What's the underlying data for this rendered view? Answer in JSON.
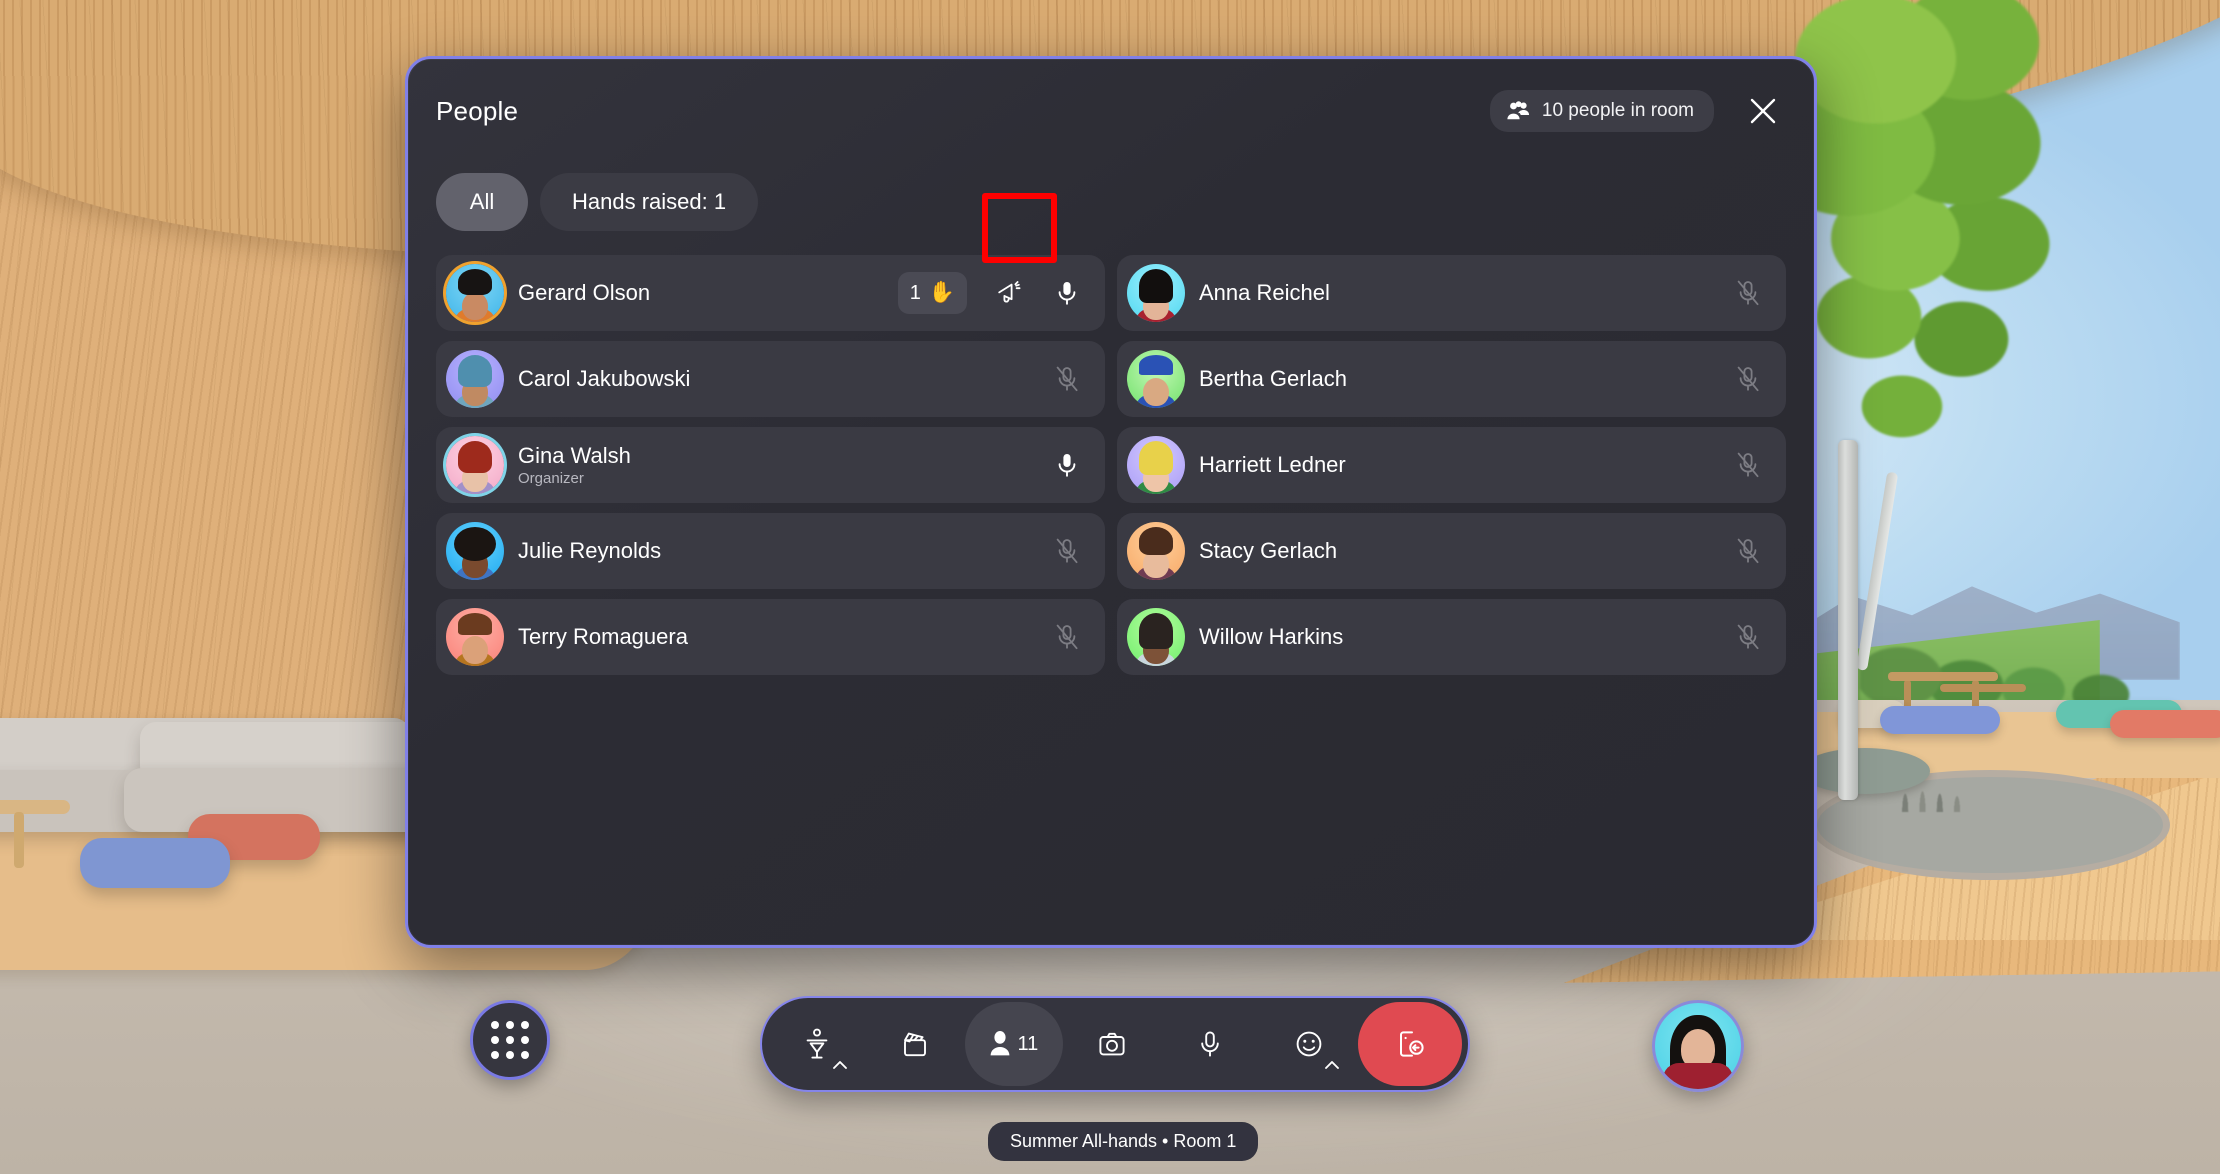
{
  "app": {
    "environment_name": "immersive-3d-lounge",
    "meeting_label": "Summer All-hands • Room 1"
  },
  "panel": {
    "title": "People",
    "room_count_label": "10 people in room",
    "room_count_icon": "people-group-icon",
    "close_icon": "close-icon",
    "filters": [
      {
        "label": "All",
        "selected": true
      },
      {
        "label": "Hands raised: 1",
        "selected": false
      }
    ]
  },
  "participants": {
    "left": [
      {
        "name": "Gerard Olson",
        "role": "",
        "hand_raised": true,
        "hand_order": "1",
        "hand_emoji": "✋",
        "has_announce": true,
        "mic_state": "unmuted",
        "avatar": {
          "bg": "#58c6f0",
          "hair": "#171413",
          "skin": "#c98a63",
          "shirt": "#e07b2c",
          "ring": "#f0a22e"
        }
      },
      {
        "name": "Carol Jakubowski",
        "role": "",
        "hand_raised": false,
        "has_announce": false,
        "mic_state": "muted",
        "avatar": {
          "bg": "#9d9bf2",
          "hair": "#4f8fae",
          "skin": "#c08a62",
          "shirt": "#6fa6bd",
          "ring": ""
        }
      },
      {
        "name": "Gina Walsh",
        "role": "Organizer",
        "hand_raised": false,
        "has_announce": false,
        "mic_state": "unmuted",
        "avatar": {
          "bg": "#f6b8cf",
          "hair": "#9e2a1c",
          "skin": "#e8c2a8",
          "shirt": "#a190c9",
          "ring": "#7fd4e8"
        }
      },
      {
        "name": "Julie Reynolds",
        "role": "",
        "hand_raised": false,
        "has_announce": false,
        "mic_state": "muted",
        "avatar": {
          "bg": "#2fb8f2",
          "hair": "#1b1512",
          "skin": "#7a4a2e",
          "shirt": "#3f74c4",
          "ring": ""
        }
      },
      {
        "name": "Terry Romaguera",
        "role": "",
        "hand_raised": false,
        "has_announce": false,
        "mic_state": "muted",
        "avatar": {
          "bg": "#f9938c",
          "hair": "#6b3b1f",
          "skin": "#dba179",
          "shirt": "#b5751f",
          "ring": ""
        }
      }
    ],
    "right": [
      {
        "name": "Anna Reichel",
        "role": "",
        "hand_raised": false,
        "has_announce": false,
        "mic_state": "muted",
        "avatar": {
          "bg": "#6ee2f3",
          "hair": "#120f0e",
          "skin": "#e3b498",
          "shirt": "#a8202f",
          "ring": ""
        }
      },
      {
        "name": "Bertha Gerlach",
        "role": "",
        "hand_raised": false,
        "has_announce": false,
        "mic_state": "muted",
        "avatar": {
          "bg": "#8ced7f",
          "hair": "#2a52b5",
          "skin": "#d9a982",
          "shirt": "#2a52b5",
          "ring": ""
        }
      },
      {
        "name": "Harriett Ledner",
        "role": "",
        "hand_raised": false,
        "has_announce": false,
        "mic_state": "muted",
        "avatar": {
          "bg": "#b6aaf6",
          "hair": "#e8d14a",
          "skin": "#eec5a8",
          "shirt": "#2f8a43",
          "ring": ""
        }
      },
      {
        "name": "Stacy Gerlach",
        "role": "",
        "hand_raised": false,
        "has_announce": false,
        "mic_state": "muted",
        "avatar": {
          "bg": "#f8bb7a",
          "hair": "#4a2c1c",
          "skin": "#e8bb9c",
          "shirt": "#6f3b52",
          "ring": ""
        }
      },
      {
        "name": "Willow Harkins",
        "role": "",
        "hand_raised": false,
        "has_announce": false,
        "mic_state": "muted",
        "avatar": {
          "bg": "#8ff07f",
          "hair": "#2a2320",
          "skin": "#7d5238",
          "shirt": "#c9d6dd",
          "ring": ""
        }
      }
    ]
  },
  "toolbar": {
    "apps_button_label": "Apps",
    "items": [
      {
        "name": "avatar-button",
        "icon": "avatar-stand-icon",
        "label": "",
        "has_chevron": true,
        "active": false,
        "style": "normal"
      },
      {
        "name": "video-button",
        "icon": "clapperboard-icon",
        "label": "",
        "has_chevron": false,
        "active": false,
        "style": "normal"
      },
      {
        "name": "people-button",
        "icon": "person-icon",
        "label": "11",
        "has_chevron": false,
        "active": true,
        "style": "normal"
      },
      {
        "name": "camera-button",
        "icon": "camera-icon",
        "label": "",
        "has_chevron": false,
        "active": false,
        "style": "normal"
      },
      {
        "name": "mic-button",
        "icon": "microphone-icon",
        "label": "",
        "has_chevron": false,
        "active": false,
        "style": "normal"
      },
      {
        "name": "reactions-button",
        "icon": "smiley-icon",
        "label": "",
        "has_chevron": true,
        "active": false,
        "style": "normal"
      },
      {
        "name": "leave-button",
        "icon": "leave-call-icon",
        "label": "",
        "has_chevron": false,
        "active": false,
        "style": "leave"
      }
    ]
  },
  "colors": {
    "panel_border": "#8080e8",
    "panel_bg": "#2c2c34",
    "row_bg": "#3a3a43",
    "pill_selected": "#62626c",
    "pill_unselected": "#3b3b44",
    "leave_red": "#e04a51",
    "highlight_red": "#fe0000",
    "accent_purple": "#7a7ae4"
  }
}
